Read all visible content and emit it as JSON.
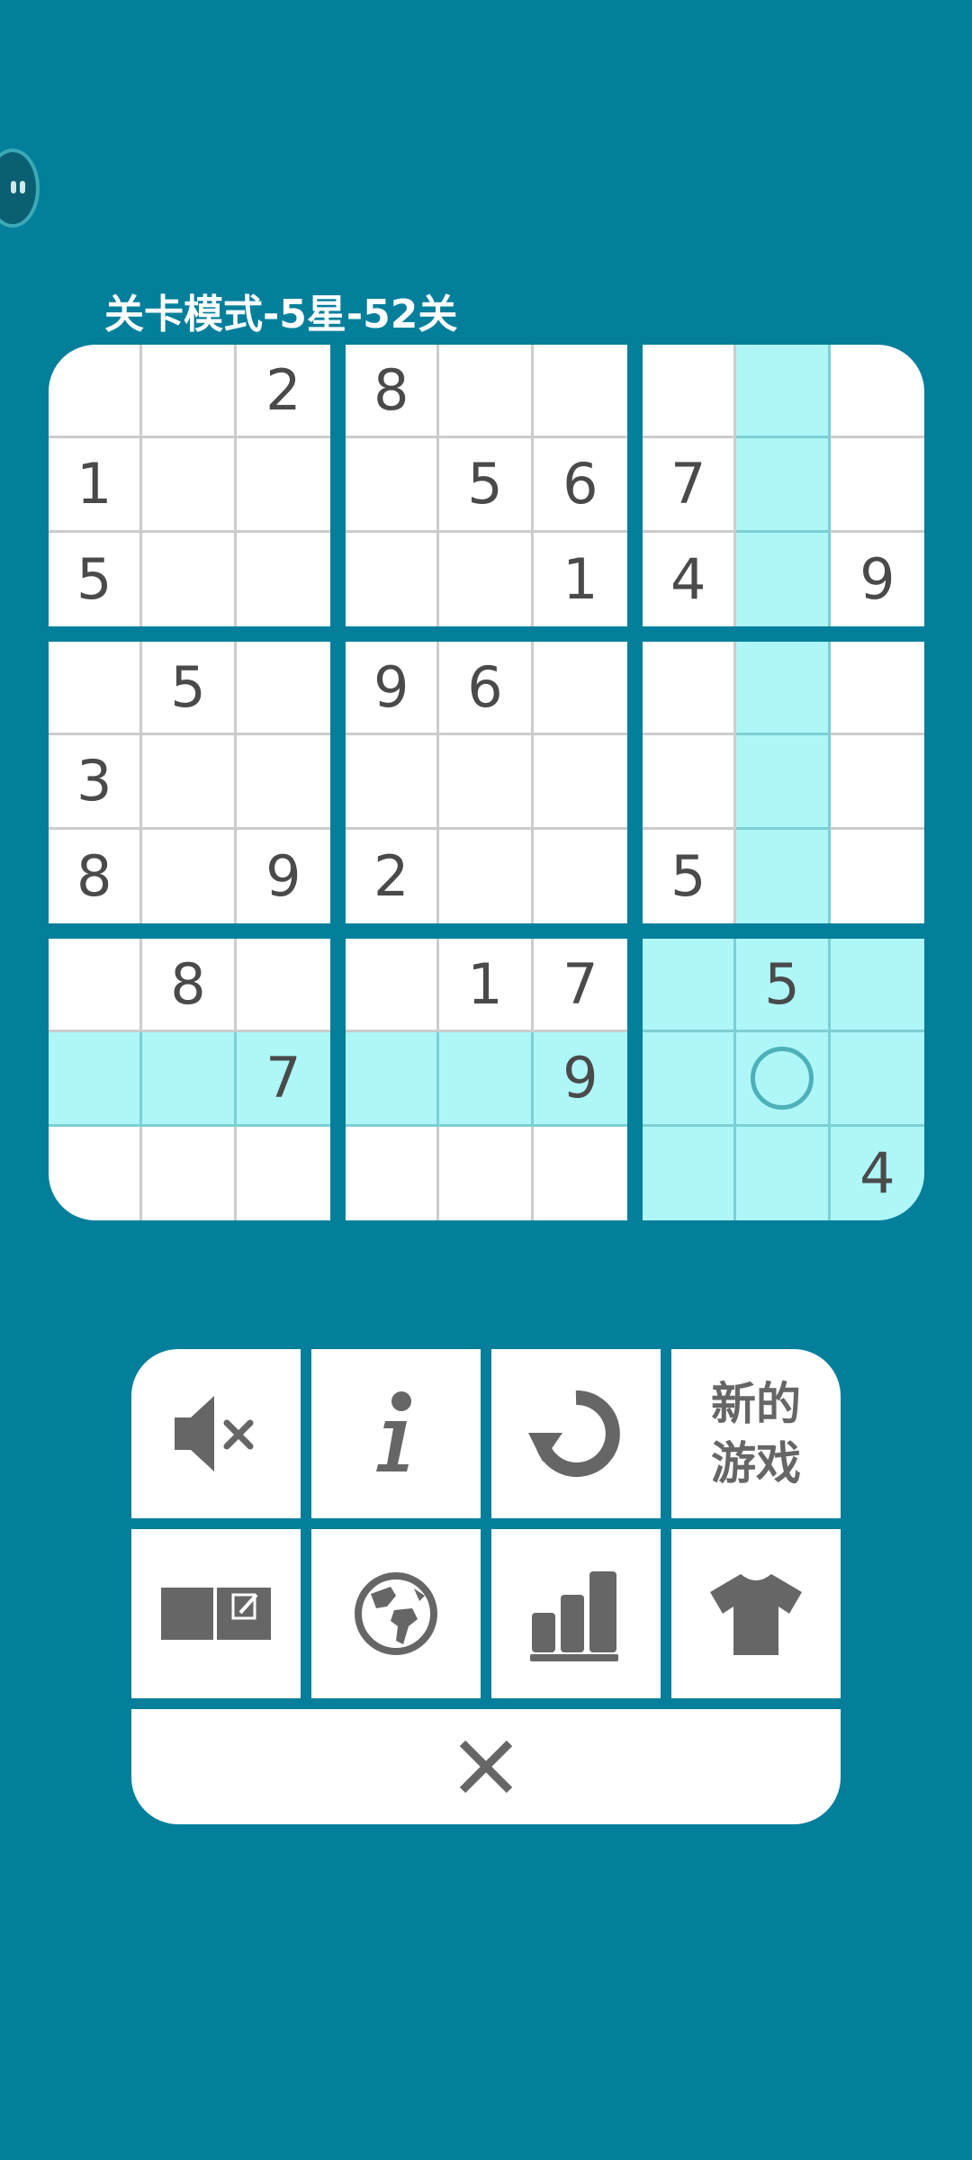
{
  "level_title": "关卡模式-5星-52关",
  "board": [
    [
      "",
      "",
      "2",
      "8",
      "",
      "",
      "",
      "",
      ""
    ],
    [
      "1",
      "",
      "",
      "",
      "5",
      "6",
      "7",
      "",
      ""
    ],
    [
      "5",
      "",
      "",
      "",
      "",
      "1",
      "4",
      "",
      "9"
    ],
    [
      "",
      "5",
      "",
      "9",
      "6",
      "",
      "",
      "",
      ""
    ],
    [
      "3",
      "",
      "",
      "",
      "",
      "",
      "",
      "",
      ""
    ],
    [
      "8",
      "",
      "9",
      "2",
      "",
      "",
      "5",
      "",
      ""
    ],
    [
      "",
      "8",
      "",
      "",
      "1",
      "7",
      "",
      "5",
      ""
    ],
    [
      "",
      "",
      "7",
      "",
      "",
      "9",
      "",
      "",
      ""
    ],
    [
      "",
      "",
      "",
      "",
      "",
      "",
      "",
      "",
      "4"
    ]
  ],
  "selected_cell": {
    "row": 7,
    "col": 7
  },
  "menu": {
    "new_game_label": "新的游戏",
    "icons": {
      "mute": "speaker-muted-icon",
      "info": "info-icon",
      "restart": "restart-icon",
      "notes": "notes-icon",
      "globe": "globe-icon",
      "stats": "stats-icon",
      "theme": "tshirt-icon",
      "close": "close-icon"
    }
  },
  "colors": {
    "background": "#037f9b",
    "highlight": "#aef6f8",
    "digit": "#4a4a4a",
    "icon": "#666666"
  }
}
